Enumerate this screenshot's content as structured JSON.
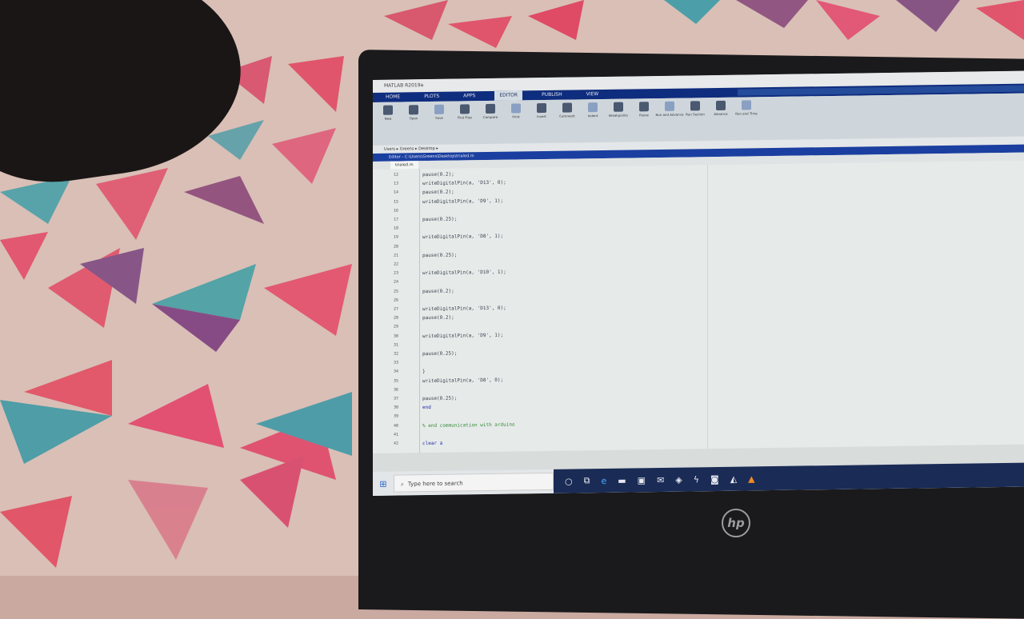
{
  "window": {
    "title": "MATLAB R2019a"
  },
  "ribbon_tabs": [
    "HOME",
    "PLOTS",
    "APPS",
    "EDITOR",
    "PUBLISH",
    "VIEW"
  ],
  "active_tab": "EDITOR",
  "ribbon_buttons": [
    {
      "label": "New",
      "icon": "new-file-icon"
    },
    {
      "label": "Open",
      "icon": "open-folder-icon"
    },
    {
      "label": "Save",
      "icon": "save-icon"
    },
    {
      "label": "Find Files",
      "icon": "find-files-icon"
    },
    {
      "label": "Compare",
      "icon": "compare-icon"
    },
    {
      "label": "Print",
      "icon": "print-icon"
    },
    {
      "label": "Insert",
      "icon": "insert-icon"
    },
    {
      "label": "Comment",
      "icon": "comment-icon"
    },
    {
      "label": "Indent",
      "icon": "indent-icon"
    },
    {
      "label": "Breakpoints",
      "icon": "breakpoints-icon"
    },
    {
      "label": "Pause",
      "icon": "pause-icon"
    },
    {
      "label": "Run and Advance",
      "icon": "run-advance-icon"
    },
    {
      "label": "Run Section",
      "icon": "run-section-icon"
    },
    {
      "label": "Advance",
      "icon": "advance-icon"
    },
    {
      "label": "Run and Time",
      "icon": "run-time-icon"
    }
  ],
  "path": "Users ▸ Greens ▸ Desktop ▸",
  "editor": {
    "title": "Editor - C:\\Users\\Greens\\Desktop\\trialed.m",
    "tab": "trialed.m",
    "lines": [
      {
        "n": "12",
        "text": "    pause(0.2);"
      },
      {
        "n": "13",
        "text": "    writeDigitalPin(a, 'D13', 0);"
      },
      {
        "n": "14",
        "text": "  pause(0.2);"
      },
      {
        "n": "15",
        "text": "    writeDigitalPin(a, 'D9', 1);"
      },
      {
        "n": "16",
        "text": ""
      },
      {
        "n": "17",
        "text": "    pause(0.25);"
      },
      {
        "n": "18",
        "text": ""
      },
      {
        "n": "19",
        "text": "    writeDigitalPin(a, 'D8', 1);"
      },
      {
        "n": "20",
        "text": ""
      },
      {
        "n": "21",
        "text": "    pause(0.25);"
      },
      {
        "n": "22",
        "text": ""
      },
      {
        "n": "23",
        "text": "  writeDigitalPin(a, 'D10', 1);"
      },
      {
        "n": "24",
        "text": ""
      },
      {
        "n": "25",
        "text": "    pause(0.2);"
      },
      {
        "n": "26",
        "text": ""
      },
      {
        "n": "27",
        "text": "    writeDigitalPin(a, 'D13', 0);"
      },
      {
        "n": "28",
        "text": "  pause(0.2);"
      },
      {
        "n": "29",
        "text": ""
      },
      {
        "n": "30",
        "text": "    writeDigitalPin(a, 'D9', 1);"
      },
      {
        "n": "31",
        "text": ""
      },
      {
        "n": "32",
        "text": "    pause(0.25);"
      },
      {
        "n": "33",
        "text": ""
      },
      {
        "n": "34",
        "text": "  }"
      },
      {
        "n": "35",
        "text": "    writeDigitalPin(a, 'D8', 0);"
      },
      {
        "n": "36",
        "text": ""
      },
      {
        "n": "37",
        "text": "    pause(0.25);"
      },
      {
        "n": "38",
        "text": "  end"
      },
      {
        "n": "39",
        "text": ""
      },
      {
        "n": "40",
        "text": "    % end communication with arduino"
      },
      {
        "n": "41",
        "text": ""
      },
      {
        "n": "42",
        "text": "  clear a"
      }
    ]
  },
  "taskbar": {
    "search_placeholder": "Type here to search",
    "icons": [
      "cortana-icon",
      "task-view-icon",
      "edge-icon",
      "file-explorer-icon",
      "store-icon",
      "mail-icon",
      "dropbox-icon",
      "lightning-icon",
      "camera-icon",
      "matlab-icon",
      "vlc-icon"
    ]
  },
  "brand": "hp",
  "colors": {
    "ribbon_blue": "#0f2d7e",
    "editor_title_blue": "#1b3fa0",
    "code_bg": "#e6ebea",
    "taskbar_dark": "#1a2b55"
  }
}
